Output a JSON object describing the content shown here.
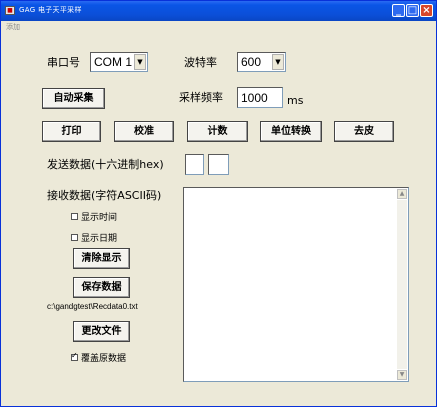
{
  "window": {
    "title": "GAG 电子天平采样",
    "menu": "添加",
    "controls": {
      "minimize": "_",
      "maximize": "□",
      "close": "×"
    }
  },
  "serial": {
    "port_label": "串口号",
    "port_value": "COM 1",
    "baud_label": "波特率",
    "baud_value": "600"
  },
  "auto_sample_button": "自动采集",
  "sample_rate": {
    "label": "采样频率",
    "value": "1000",
    "unit": "ms"
  },
  "toolbar": {
    "print": "打印",
    "calibrate": "校准",
    "count": "计数",
    "unit_convert": "单位转换",
    "tare": "去皮"
  },
  "send": {
    "label": "发送数据(十六进制hex)",
    "value1": "",
    "value2": ""
  },
  "receive": {
    "label": "接收数据(字符ASCII码)",
    "content": ""
  },
  "options": {
    "show_time": {
      "label": "显示时间",
      "checked": false
    },
    "show_date": {
      "label": "显示日期",
      "checked": false
    }
  },
  "clear_button": "清除显示",
  "save_button": "保存数据",
  "file_path": "c:\\gandgtest\\Recdata0.txt",
  "change_file_button": "更改文件",
  "overwrite": {
    "label": "覆盖原数据",
    "checked": true
  },
  "icons": {
    "window_icon": "app-icon",
    "dropdown": "chevron-down-icon"
  }
}
